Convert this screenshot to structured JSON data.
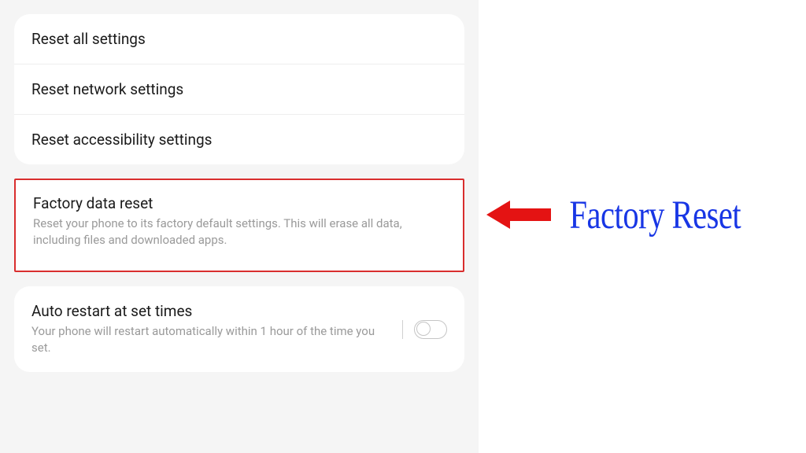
{
  "reset_group": {
    "items": [
      {
        "title": "Reset all settings"
      },
      {
        "title": "Reset network settings"
      },
      {
        "title": "Reset accessibility settings"
      }
    ]
  },
  "factory": {
    "title": "Factory data reset",
    "desc": "Reset your phone to its factory default settings. This will erase all data, including files and downloaded apps."
  },
  "auto_restart": {
    "title": "Auto restart at set times",
    "desc": "Your phone will restart automatically within 1 hour of the time you set.",
    "enabled": false
  },
  "annotation": {
    "label": "Factory Reset",
    "arrow_color": "#e41313",
    "label_color": "#1836e5"
  }
}
